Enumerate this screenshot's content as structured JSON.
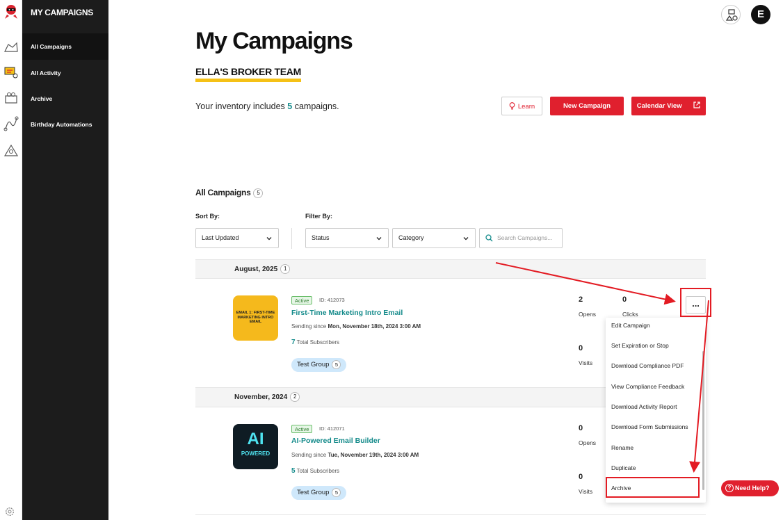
{
  "sidebar": {
    "title": "MY CAMPAIGNS",
    "items": [
      {
        "label": "All Campaigns"
      },
      {
        "label": "All Activity"
      },
      {
        "label": "Archive"
      },
      {
        "label": "Birthday Automations"
      }
    ]
  },
  "header": {
    "avatar_letter": "E"
  },
  "page": {
    "title": "My Campaigns",
    "team": "ELLA'S BROKER TEAM",
    "inventory_prefix": "Your inventory includes",
    "inventory_count": "5",
    "inventory_suffix": "campaigns.",
    "learn_label": "Learn",
    "new_campaign_label": "New Campaign",
    "calendar_label": "Calendar View"
  },
  "list": {
    "heading": "All Campaigns",
    "count": "5",
    "sort_label": "Sort By:",
    "sort_value": "Last Updated",
    "filter_label": "Filter By:",
    "status_value": "Status",
    "category_value": "Category",
    "search_placeholder": "Search Campaigns..."
  },
  "groups": [
    {
      "label": "August, 2025",
      "count": "1"
    },
    {
      "label": "November, 2024",
      "count": "2"
    }
  ],
  "campaigns": [
    {
      "status": "Active",
      "id": "ID: 412073",
      "name": "First-Time Marketing Intro Email",
      "since_prefix": "Sending since",
      "since": "Mon, November 18th, 2024 3:00 AM",
      "subs_count": "7",
      "subs_label": "Total Subscribers",
      "group": "Test Group",
      "group_count": "5",
      "opens": "2",
      "opens_label": "Opens",
      "clicks": "0",
      "clicks_label": "Clicks",
      "visits": "0",
      "visits_label": "Visits",
      "thumb_text": "EMAIL 1: FIRST-TIME MARKETING INTRO EMAIL"
    },
    {
      "status": "Active",
      "id": "ID: 412071",
      "name": "AI-Powered Email Builder",
      "since_prefix": "Sending since",
      "since": "Tue, November 19th, 2024 3:00 AM",
      "subs_count": "5",
      "subs_label": "Total Subscribers",
      "group": "Test Group",
      "group_count": "5",
      "opens": "0",
      "opens_label": "Opens",
      "visits": "0",
      "visits_label": "Visits",
      "thumb_text_1": "AI",
      "thumb_text_2": "POWERED"
    }
  ],
  "menu": {
    "items": [
      "Edit Campaign",
      "Set Expiration or Stop",
      "Download Compliance PDF",
      "View Compliance Feedback",
      "Download Activity Report",
      "Download Form Submissions",
      "Rename",
      "Duplicate",
      "Archive"
    ]
  },
  "more_label": "...",
  "help_label": "Need Help?",
  "colors": {
    "accent_red": "#e0202e",
    "teal": "#138a8a",
    "yellow": "#f5c116",
    "sidebar_bg": "#1c1c1c",
    "annotation_red": "#e31b23"
  }
}
